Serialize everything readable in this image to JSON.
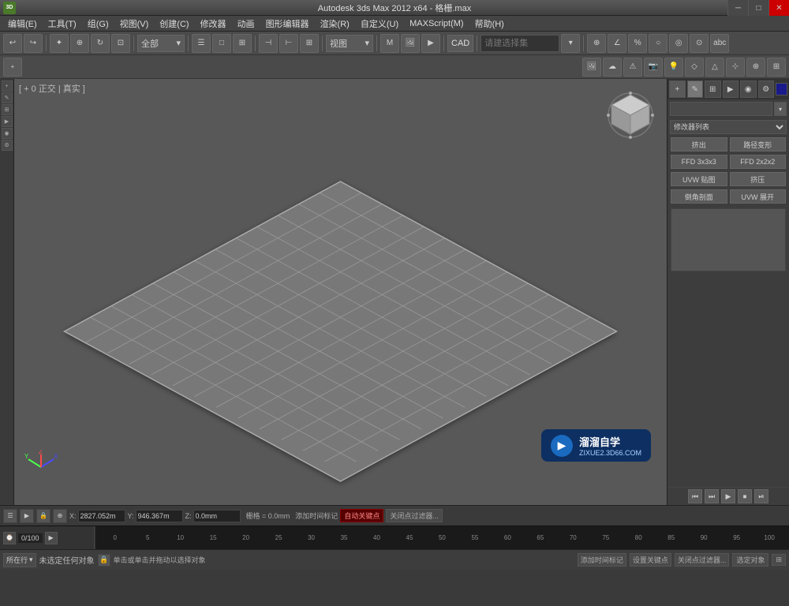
{
  "titlebar": {
    "title": "Autodesk 3ds Max  2012 x64 - 格栅.max",
    "app_icon": "3D",
    "minimize_label": "─",
    "restore_label": "□",
    "close_label": "✕"
  },
  "menubar": {
    "items": [
      {
        "label": "编辑(E)"
      },
      {
        "label": "工具(T)"
      },
      {
        "label": "组(G)"
      },
      {
        "label": "视图(V)"
      },
      {
        "label": "创建(C)"
      },
      {
        "label": "修改器"
      },
      {
        "label": "动画"
      },
      {
        "label": "图形编辑器"
      },
      {
        "label": "渲染(R)"
      },
      {
        "label": "自定义(U)"
      },
      {
        "label": "MAXScript(M)"
      },
      {
        "label": "帮助(H)"
      }
    ]
  },
  "toolbar1": {
    "dropdown_all_label": "全部",
    "selection_input_placeholder": "请建选择集",
    "cad_label": "CAD"
  },
  "viewport": {
    "label": "[ + 0 正交 | 真实 ]",
    "background_color": "#585858",
    "grid_color": "#888888",
    "grid_bg": "#5a5a5a"
  },
  "right_panel": {
    "modifier_list_label": "修改器列表",
    "btn_push": "挤出",
    "btn_path_deform": "路径变形",
    "btn_ffd3x3": "FFD 3x3x3",
    "btn_ffd2x2": "FFD 2x2x2",
    "btn_uvw_map": "UVW 贴图",
    "btn_push2": "挤压",
    "btn_chamfer": "倒角剖面",
    "btn_uvw_unwrap": "UVW 展开",
    "playback_buttons": [
      "⏮",
      "⏭",
      "▶",
      "⏹",
      "⏯"
    ]
  },
  "statusbar": {
    "x_label": "X:",
    "x_value": "2827.052m",
    "y_label": "Y:",
    "y_value": "946.367m",
    "z_label": "Z:",
    "z_value": "0.0mm",
    "grid_label": "栅格 = 0.0mm",
    "add_time_tag": "添加时间标记",
    "auto_key_label": "自动关键点",
    "filter_label": "关闭点过滤器..."
  },
  "timeline": {
    "current_frame": "0",
    "total_frames": "100",
    "frame_ticks": [
      "0",
      "5",
      "10",
      "15",
      "20",
      "25",
      "30",
      "35",
      "40",
      "45",
      "50",
      "55",
      "60",
      "65",
      "70",
      "75",
      "80",
      "85",
      "90",
      "95",
      "100"
    ]
  },
  "bottom_bar": {
    "mode_label": "所在行",
    "status_message": "未选定任何对象",
    "hint": "单击或单击并拖动以选择对象",
    "selection_btn": "选定对象"
  },
  "watermark": {
    "icon": "▶",
    "brand": "溜溜自学",
    "url": "ZIXUE2.3D66.COM"
  }
}
